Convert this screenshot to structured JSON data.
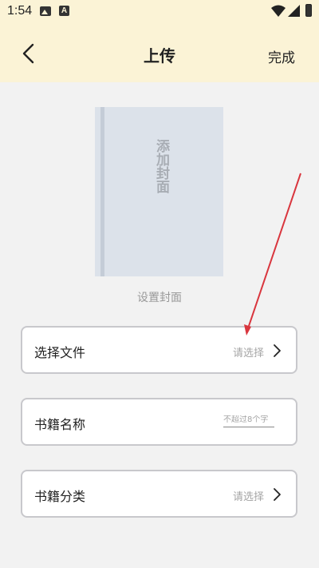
{
  "status_bar": {
    "time": "1:54",
    "icons": [
      "image-icon",
      "a-icon",
      "wifi-icon",
      "signal-icon",
      "battery-icon"
    ]
  },
  "nav": {
    "back_icon": "chevron-left-icon",
    "title": "上传",
    "done_label": "完成"
  },
  "cover": {
    "placeholder_text": "添加封面",
    "caption": "设置封面"
  },
  "fields": {
    "file": {
      "label": "选择文件",
      "hint": "请选择"
    },
    "name": {
      "label": "书籍名称",
      "placeholder": "不超过8个字"
    },
    "category": {
      "label": "书籍分类",
      "hint": "请选择"
    }
  },
  "colors": {
    "header_bg": "#fbf3d6",
    "page_bg": "#f2f2f2",
    "card_border": "#c8c8cc",
    "cover_bg": "#dce2ea",
    "annotation_arrow": "#d9363e"
  }
}
